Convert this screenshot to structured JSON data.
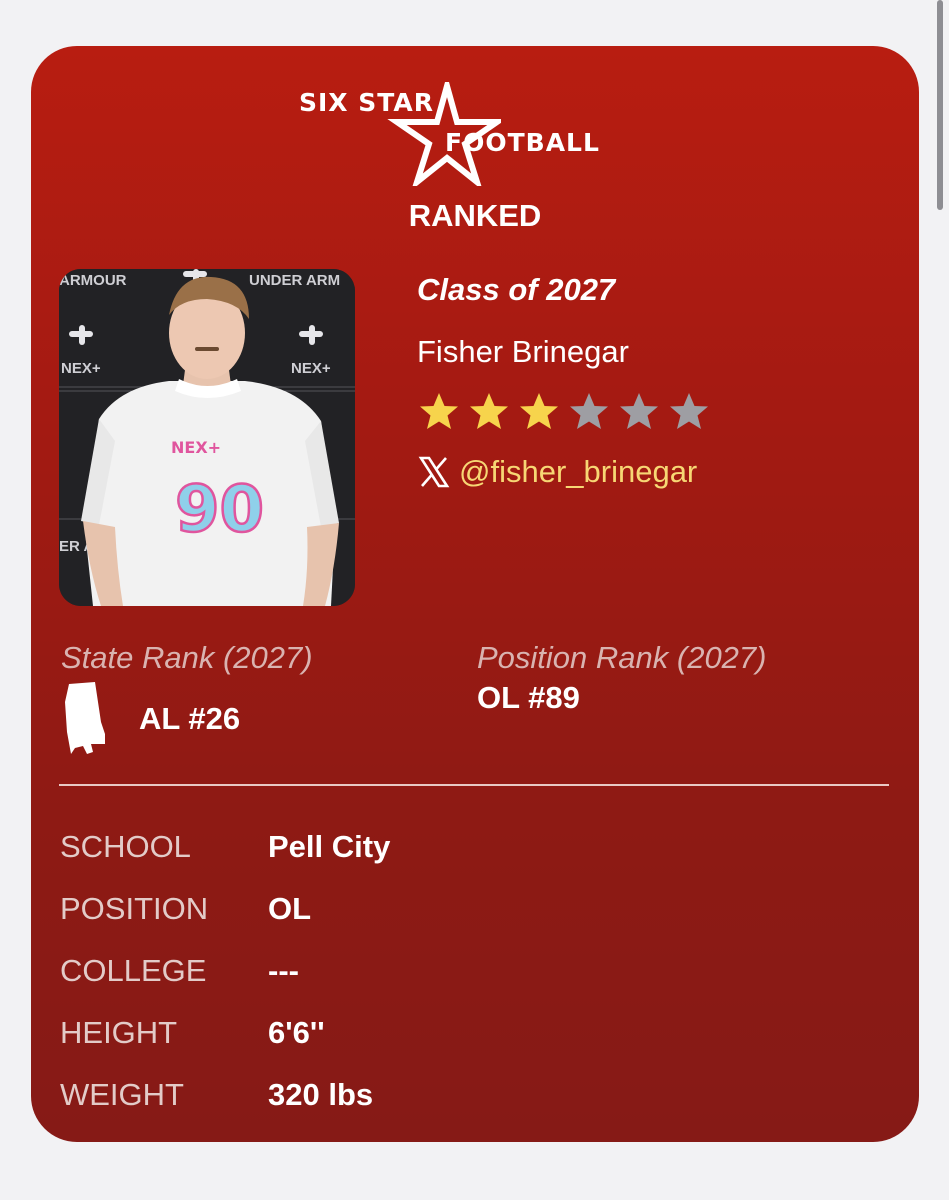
{
  "header": {
    "logo_text_top": "SIX STAR",
    "logo_text_bottom": "FOOTBALL",
    "badge": "RANKED"
  },
  "player": {
    "class_label": "Class of 2027",
    "name": "Fisher Brinegar",
    "star_rating": 3,
    "star_max": 6,
    "social_handle": "@fisher_brinegar",
    "social_icon": "x-logo-icon"
  },
  "ranks": {
    "state": {
      "title": "State Rank (2027)",
      "value": "AL #26",
      "icon": "alabama-state-icon"
    },
    "position": {
      "title": "Position Rank (2027)",
      "value": "OL #89"
    }
  },
  "details": [
    {
      "label": "SCHOOL",
      "value": "Pell City"
    },
    {
      "label": "POSITION",
      "value": "OL"
    },
    {
      "label": "COLLEGE",
      "value": "---"
    },
    {
      "label": "HEIGHT",
      "value": "6'6''"
    },
    {
      "label": "WEIGHT",
      "value": "320 lbs"
    }
  ],
  "photo": {
    "backdrop_texts": [
      "ARMOUR",
      "UNDER ARM",
      "NEX+",
      "NEX+",
      "ER AR",
      "R A"
    ],
    "jersey_brand": "NEX+",
    "jersey_number": "90"
  },
  "colors": {
    "card_top": "#b81d11",
    "card_bottom": "#861a16",
    "star_filled": "#f7d44c",
    "star_empty": "#9e9ea3",
    "handle": "#f7d774",
    "jersey_number": "#8fd0ea",
    "jersey_pink": "#e0559e"
  }
}
